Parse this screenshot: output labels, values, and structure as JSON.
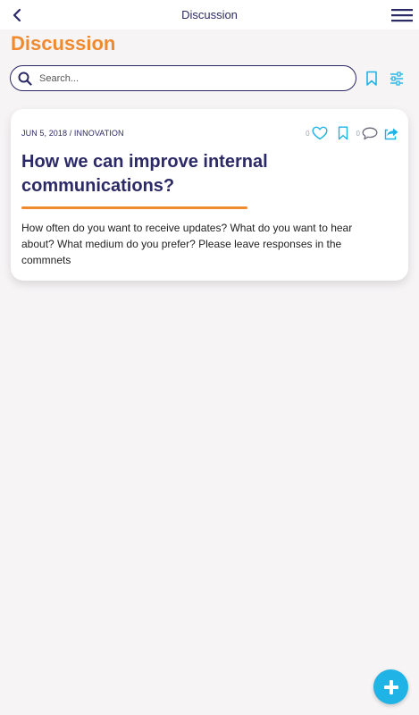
{
  "header": {
    "title": "Discussion",
    "back_icon": "chevron-left-icon",
    "menu_icon": "hamburger-menu-icon"
  },
  "page": {
    "heading": "Discussion"
  },
  "search": {
    "placeholder": "Search...",
    "value": ""
  },
  "post": {
    "meta": "JUN 5, 2018 / INNOVATION",
    "title": "How we can improve internal communications?",
    "body": "How often do you want to receive updates? What do you want to hear about? What medium do you prefer? Please leave responses in the commnets",
    "like_count": "0",
    "comment_count": "0"
  },
  "colors": {
    "accent_orange": "#f08a2f",
    "navy": "#2c2a66",
    "cyan": "#1fb3e6",
    "background": "#f6f4f5"
  }
}
